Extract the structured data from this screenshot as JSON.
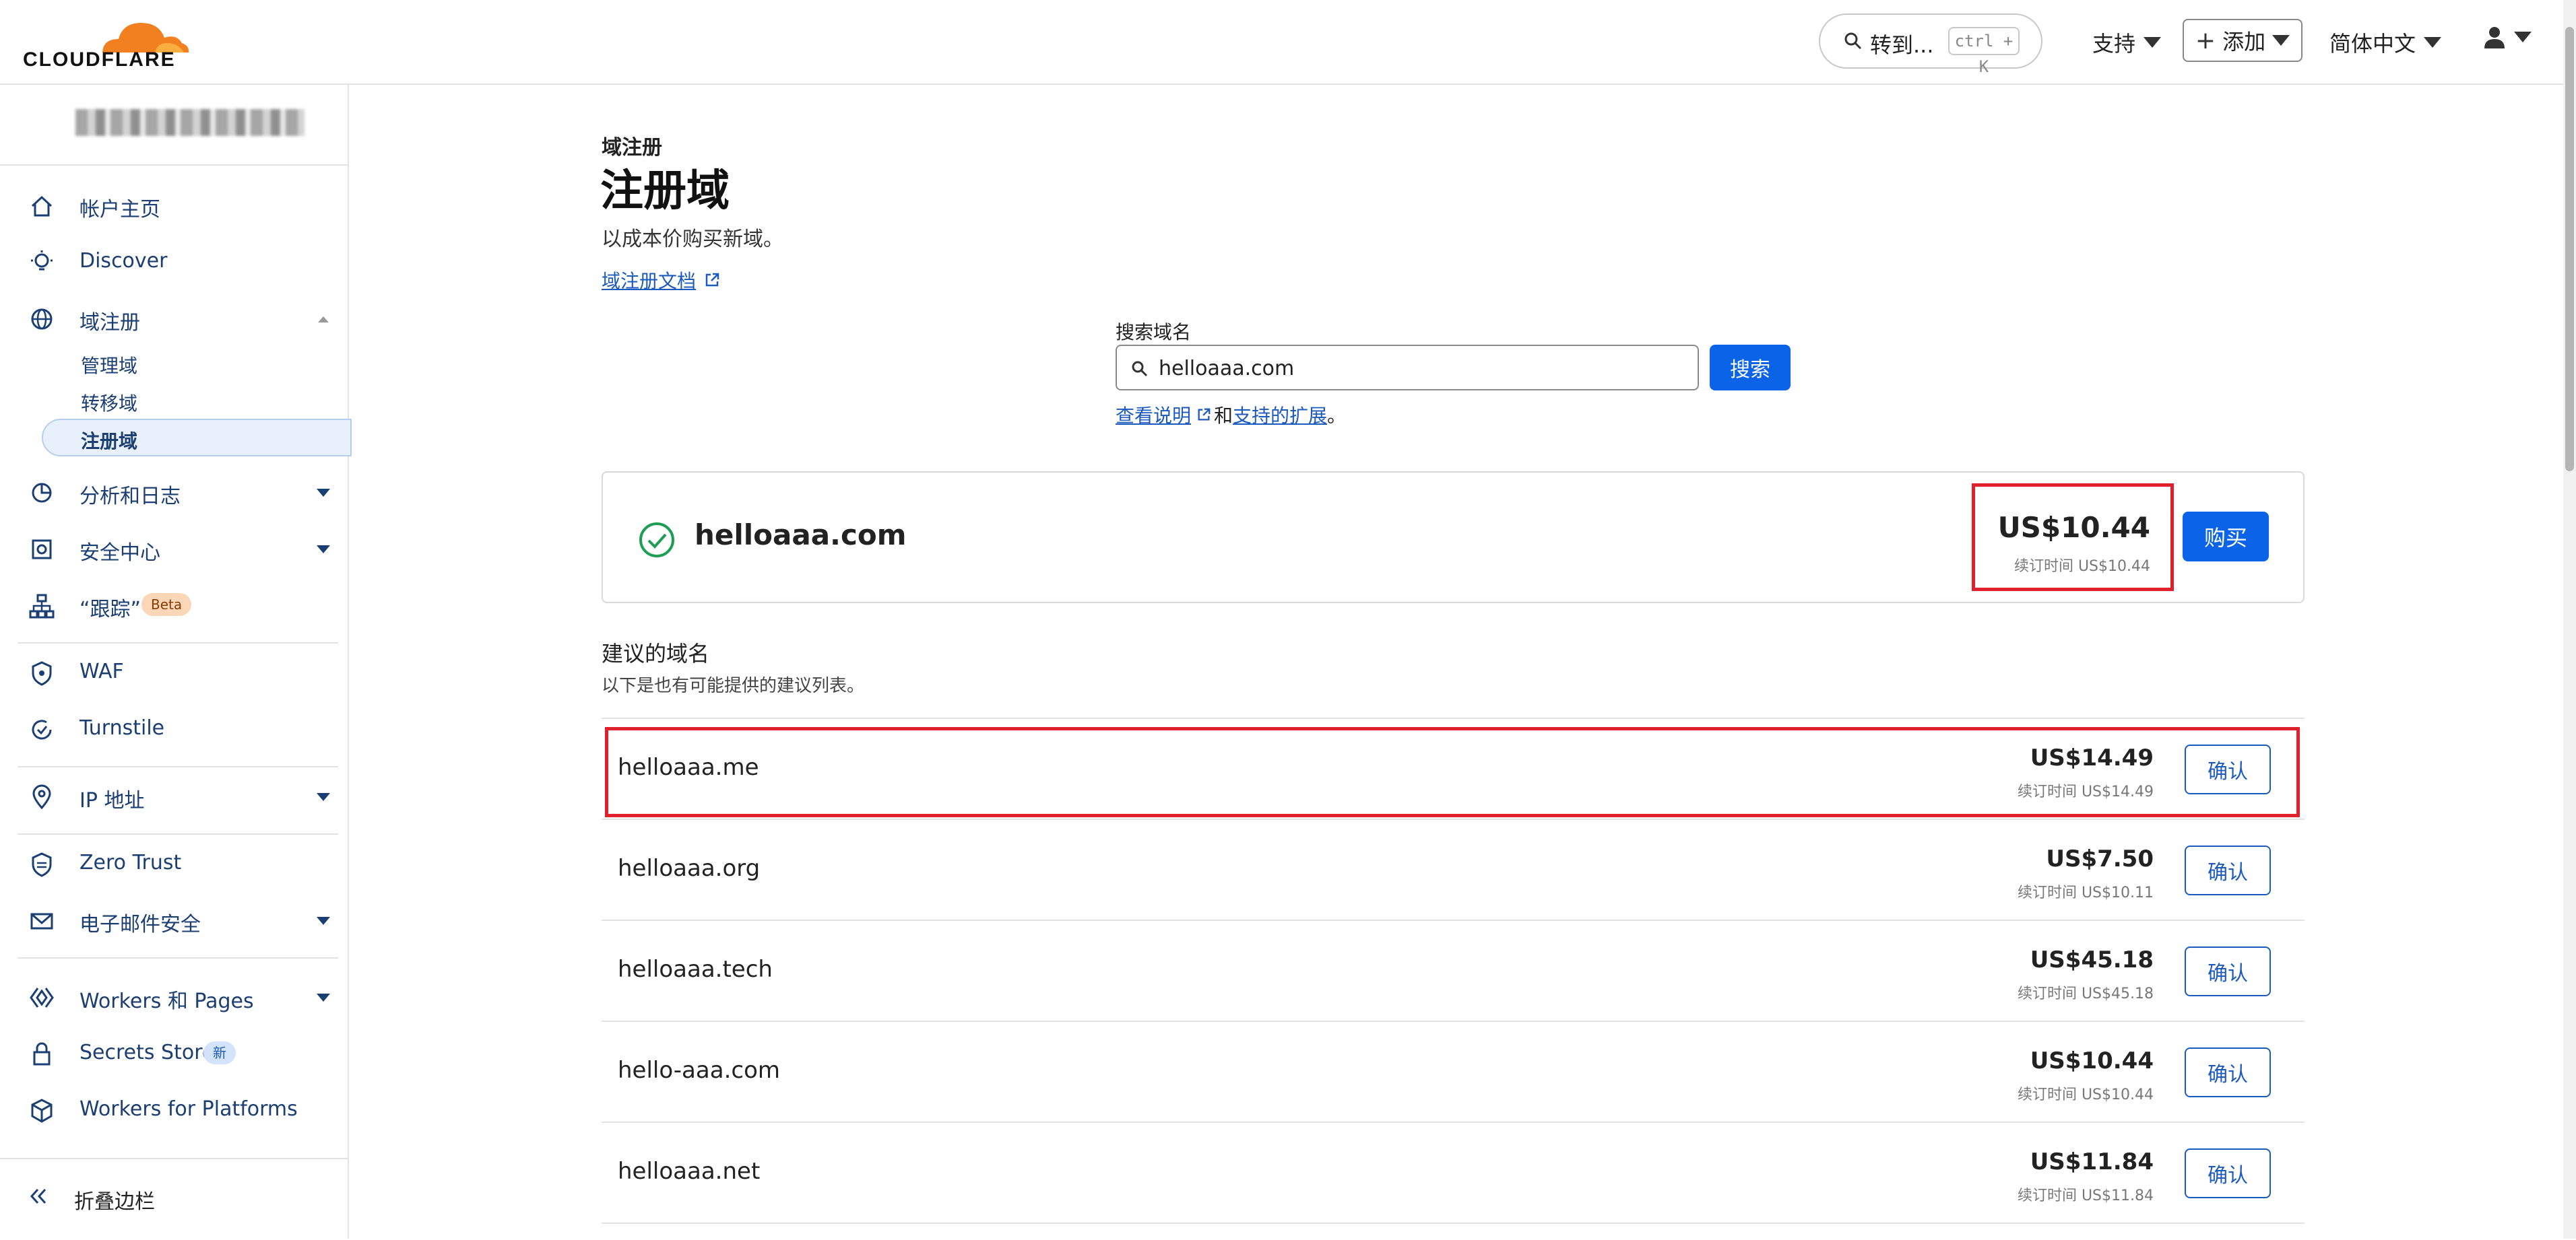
{
  "header": {
    "logo_text": "CLOUDFLARE",
    "goto_label": "转到...",
    "goto_shortcut": "ctrl + K",
    "support_label": "支持",
    "add_label": "添加",
    "language_label": "简体中文",
    "brand_color": "#f38020"
  },
  "sidebar": {
    "items": [
      {
        "label": "帐户主页"
      },
      {
        "label": "Discover"
      },
      {
        "label": "域注册"
      },
      {
        "label": "分析和日志"
      },
      {
        "label": "安全中心"
      },
      {
        "label": "“跟踪”",
        "badge": "Beta"
      },
      {
        "label": "WAF"
      },
      {
        "label": "Turnstile"
      },
      {
        "label": "IP 地址"
      },
      {
        "label": "Zero Trust"
      },
      {
        "label": "电子邮件安全"
      },
      {
        "label": "Workers 和 Pages"
      },
      {
        "label": "Secrets Store",
        "badge": "新"
      },
      {
        "label": "Workers for Platforms"
      }
    ],
    "sub_items": [
      "管理域",
      "转移域",
      "注册域"
    ],
    "collapse_label": "折叠边栏"
  },
  "main": {
    "breadcrumb": "域注册",
    "title": "注册域",
    "subtitle": "以成本价购买新域。",
    "doc_link": "域注册文档",
    "search": {
      "label": "搜索域名",
      "value": "helloaaa.com",
      "button": "搜索",
      "help_link1": "查看说明",
      "help_and": "和",
      "help_link2": "支持的扩展",
      "help_end": "。"
    },
    "result": {
      "domain": "helloaaa.com",
      "price": "US$10.44",
      "renewal": "续订时间 US$10.44",
      "buy_label": "购买"
    },
    "suggestions_title": "建议的域名",
    "suggestions_desc": "以下是也有可能提供的建议列表。",
    "suggestions": [
      {
        "domain": "helloaaa.me",
        "price": "US$14.49",
        "renewal": "续订时间 US$14.49",
        "button": "确认"
      },
      {
        "domain": "helloaaa.org",
        "price": "US$7.50",
        "renewal": "续订时间 US$10.11",
        "button": "确认"
      },
      {
        "domain": "helloaaa.tech",
        "price": "US$45.18",
        "renewal": "续订时间 US$45.18",
        "button": "确认"
      },
      {
        "domain": "hello-aaa.com",
        "price": "US$10.44",
        "renewal": "续订时间 US$10.44",
        "button": "确认"
      },
      {
        "domain": "helloaaa.net",
        "price": "US$11.84",
        "renewal": "续订时间 US$11.84",
        "button": "确认"
      }
    ],
    "accent_color": "#0b64e8",
    "highlight_color": "#e0202c"
  }
}
